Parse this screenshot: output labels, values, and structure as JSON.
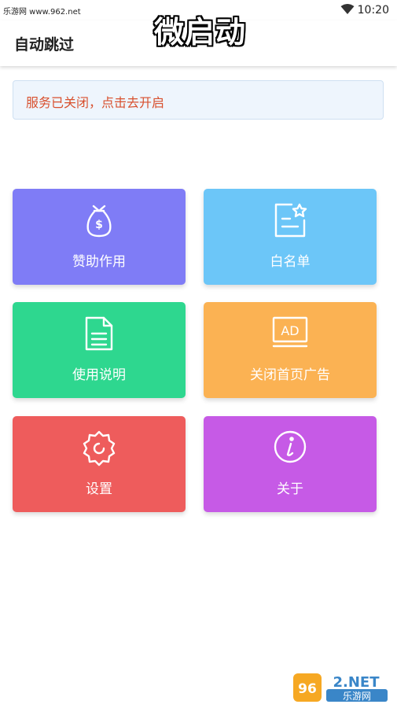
{
  "status_bar": {
    "site_text": "乐游网 www.962.net",
    "time": "10:20"
  },
  "app_bar": {
    "title": "自动跳过",
    "overlay_title": "微启动"
  },
  "notice": {
    "text": "服务已关闭，点击去开启",
    "color": "#d8502e"
  },
  "tiles": [
    {
      "label": "赞助作用",
      "icon": "money-bag-icon",
      "color": "#7f7cf6"
    },
    {
      "label": "白名单",
      "icon": "star-list-icon",
      "color": "#6cc6f8"
    },
    {
      "label": "使用说明",
      "icon": "document-icon",
      "color": "#2ed78f"
    },
    {
      "label": "关闭首页广告",
      "icon": "ad-screen-icon",
      "color": "#fbb253"
    },
    {
      "label": "设置",
      "icon": "gear-icon",
      "color": "#ee5c5c"
    },
    {
      "label": "关于",
      "icon": "info-icon",
      "color": "#c65ae6"
    }
  ],
  "watermark": {
    "top": "962.NET",
    "bottom": "乐游网"
  }
}
